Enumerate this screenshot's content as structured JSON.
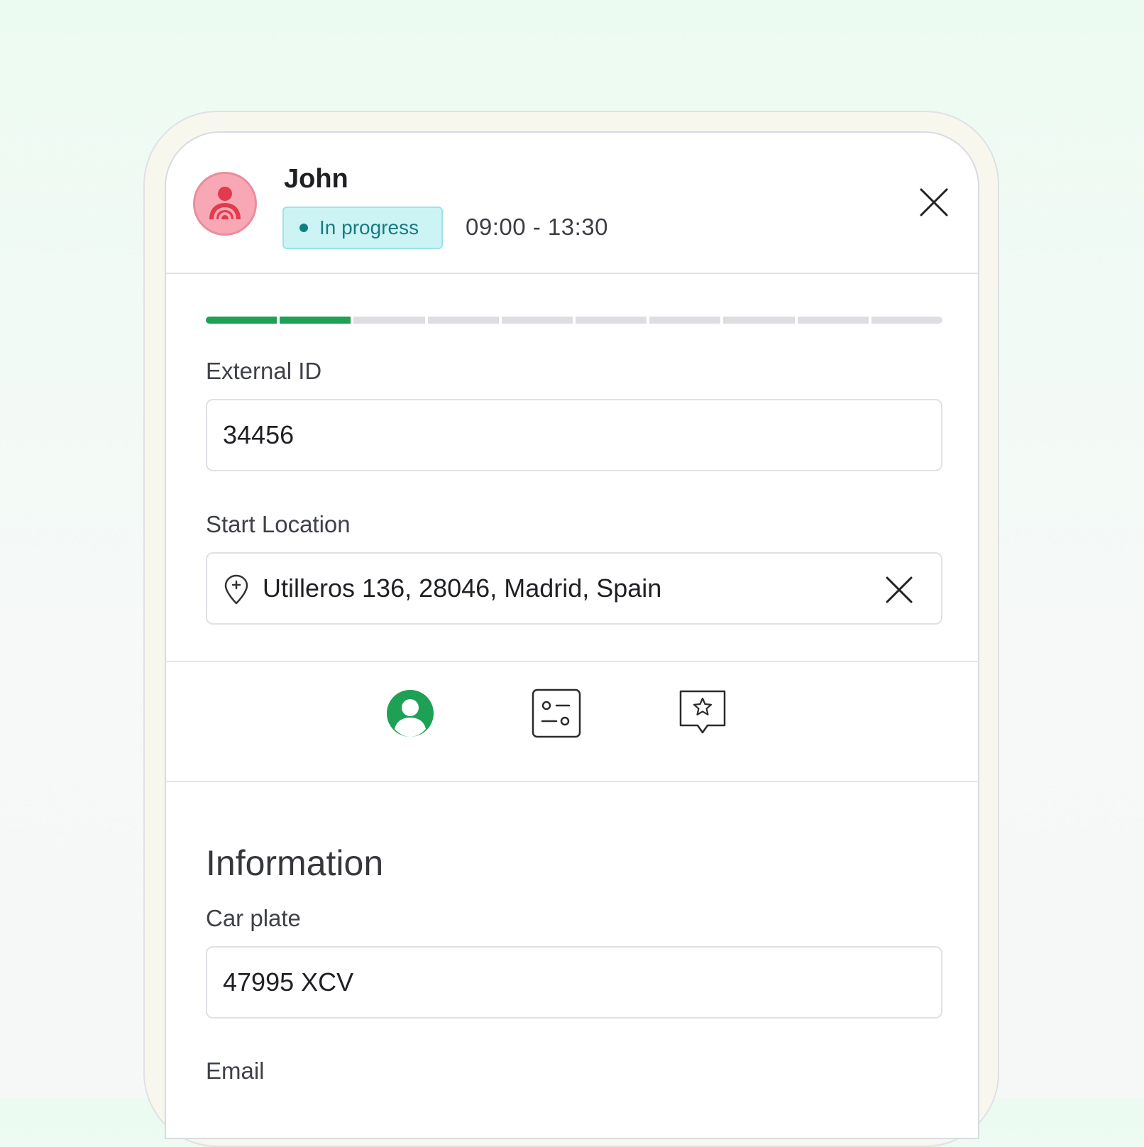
{
  "header": {
    "name": "John",
    "status": "In progress",
    "time_range": "09:00 - 13:30",
    "close_icon": "close-icon",
    "avatar_icon": "person-icon"
  },
  "progress": {
    "completed_steps": 2,
    "total_steps": 10
  },
  "external_id": {
    "label": "External ID",
    "value": "34456"
  },
  "start_location": {
    "label": "Start Location",
    "value": "Utilleros 136, 28046, Madrid, Spain",
    "icon": "location-pin-icon",
    "clear_icon": "clear-icon"
  },
  "tabs": [
    {
      "icon": "user-profile-icon",
      "active": true
    },
    {
      "icon": "settings-sliders-icon",
      "active": false
    },
    {
      "icon": "star-review-icon",
      "active": false
    }
  ],
  "information": {
    "title": "Information",
    "car_plate_label": "Car plate",
    "car_plate_value": "47995 XCV",
    "email_label": "Email"
  },
  "colors": {
    "accent_green": "#1ea055",
    "status_bg": "#cdf4f4",
    "status_text": "#1a7a83",
    "avatar_bg": "#f7a8b4"
  }
}
